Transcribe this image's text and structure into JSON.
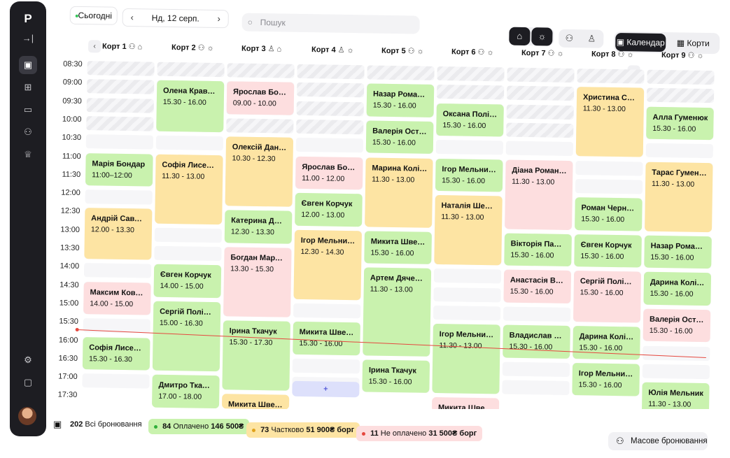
{
  "sidebar": {
    "logo": "P",
    "items": [
      {
        "name": "sidebar-collapse",
        "icon": "collapse-icon",
        "glyph": "→|"
      },
      {
        "name": "sidebar-item-calendar",
        "icon": "calendar-icon",
        "glyph": "▣",
        "active": true
      },
      {
        "name": "sidebar-item-dashboard",
        "icon": "grid-icon",
        "glyph": "⊞"
      },
      {
        "name": "sidebar-item-payments",
        "icon": "card-icon",
        "glyph": "▭"
      },
      {
        "name": "sidebar-item-clients",
        "icon": "users-icon",
        "glyph": "⚇"
      },
      {
        "name": "sidebar-item-tournaments",
        "icon": "trophy-icon",
        "glyph": "♕"
      },
      {
        "name": "sidebar-item-settings",
        "icon": "gear-icon",
        "glyph": "⚙"
      },
      {
        "name": "sidebar-item-chat",
        "icon": "chat-icon",
        "glyph": "▢"
      }
    ]
  },
  "toolbar": {
    "today_label": "Сьогодні",
    "date_label": "Нд, 12 серп.",
    "search_placeholder": "Пошук",
    "view_calendar": "Календар",
    "view_courts": "Корти"
  },
  "courts": [
    {
      "name": "Корт 1",
      "icons": "⚇ ⌂"
    },
    {
      "name": "Корт 2",
      "icons": "⚇ ☼"
    },
    {
      "name": "Корт 3",
      "icons": "♙ ⌂"
    },
    {
      "name": "Корт 4",
      "icons": "♙ ☼"
    },
    {
      "name": "Корт 5",
      "icons": "⚇ ☼"
    },
    {
      "name": "Корт 6",
      "icons": "⚇ ☼"
    },
    {
      "name": "Корт 7",
      "icons": "⚇ ☼"
    },
    {
      "name": "Корт 8",
      "icons": "⚇ ☼"
    },
    {
      "name": "Корт 9",
      "icons": "⚇ ☼"
    }
  ],
  "times": [
    "08:30",
    "09:00",
    "09:30",
    "10:00",
    "10:30",
    "11:00",
    "11:30",
    "12:00",
    "12:30",
    "13:00",
    "13:30",
    "14:00",
    "14:30",
    "15:00",
    "15:30",
    "16:00",
    "16:30",
    "17:00",
    "17:30"
  ],
  "bookings": [
    {
      "court": 0,
      "name": "Марія Бондар",
      "time": "11:00–12:00",
      "status": "g"
    },
    {
      "court": 0,
      "name": "Андрій Савчук",
      "time": "12.00 - 13.30",
      "status": "y"
    },
    {
      "court": 0,
      "name": "Максим Коваль",
      "time": "14.00 - 15.00",
      "status": "r"
    },
    {
      "court": 0,
      "name": "Софія Лисенко",
      "time": "15.30 - 16.30",
      "status": "g"
    },
    {
      "court": 1,
      "name": "Олена Кравець",
      "time": "15.30 - 16.00",
      "status": "g"
    },
    {
      "court": 1,
      "name": "Софія Лисенко",
      "time": "11.30 - 13.00",
      "status": "y"
    },
    {
      "court": 1,
      "name": "Євген Корчук",
      "time": "14.00 - 15.00",
      "status": "g"
    },
    {
      "court": 1,
      "name": "Сергій Поліщук",
      "time": "15.00 - 16.30",
      "status": "g"
    },
    {
      "court": 1,
      "name": "Дмитро Ткачук",
      "time": "17.00 - 18.00",
      "status": "g"
    },
    {
      "court": 2,
      "name": "Ярослав Бондар",
      "time": "09.00 - 10.00",
      "status": "r"
    },
    {
      "court": 2,
      "name": "Олексій Данилюк",
      "time": "10.30 - 12.30",
      "status": "y"
    },
    {
      "court": 2,
      "name": "Катерина Долинська",
      "time": "12.30 - 13.30",
      "status": "g"
    },
    {
      "court": 2,
      "name": "Богдан Марчук",
      "time": "13.30 - 15.30",
      "status": "r"
    },
    {
      "court": 2,
      "name": "Ірина Ткачук",
      "time": "15.30 - 17.30",
      "status": "g"
    },
    {
      "court": 2,
      "name": "Микита Швець",
      "time": "",
      "status": "y"
    },
    {
      "court": 3,
      "name": "Ярослав Бондар",
      "time": "11.00 - 12.00",
      "status": "r"
    },
    {
      "court": 3,
      "name": "Євген Корчук",
      "time": "12.00 - 13.00",
      "status": "g"
    },
    {
      "court": 3,
      "name": "Ігор Мельничук",
      "time": "12.30 - 14.30",
      "status": "y"
    },
    {
      "court": 3,
      "name": "Микита Швець",
      "time": "15.30 - 16.00",
      "status": "g"
    },
    {
      "court": 3,
      "name": "+",
      "time": "",
      "status": "add"
    },
    {
      "court": 4,
      "name": "Назар Романюк",
      "time": "15.30 - 16.00",
      "status": "g"
    },
    {
      "court": 4,
      "name": "Валерія Остапенко",
      "time": "15.30 - 16.00",
      "status": "g"
    },
    {
      "court": 4,
      "name": "Марина Колісник",
      "time": "11.30 - 13.00",
      "status": "y"
    },
    {
      "court": 4,
      "name": "Микита Швець",
      "time": "15.30 - 16.00",
      "status": "g"
    },
    {
      "court": 4,
      "name": "Артем Дяченко",
      "time": "11.30 - 13.00",
      "status": "g"
    },
    {
      "court": 4,
      "name": "Ірина Ткачук",
      "time": "15.30 - 16.00",
      "status": "g"
    },
    {
      "court": 5,
      "name": "Оксана Поліщук",
      "time": "15.30 - 16.00",
      "status": "g"
    },
    {
      "court": 5,
      "name": "Ігор Мельничук",
      "time": "15.30 - 16.00",
      "status": "g"
    },
    {
      "court": 5,
      "name": "Наталія Шевченко",
      "time": "11.30 - 13.00",
      "status": "y"
    },
    {
      "court": 5,
      "name": "Ігор Мельничук",
      "time": "11.30 - 13.00",
      "status": "g"
    },
    {
      "court": 5,
      "name": "Микита Швець",
      "time": "",
      "status": "r"
    },
    {
      "court": 6,
      "name": "Діана Романюк",
      "time": "11.30 - 13.00",
      "status": "r"
    },
    {
      "court": 6,
      "name": "Вікторія Павленко",
      "time": "15.30 - 16.00",
      "status": "g"
    },
    {
      "court": 6,
      "name": "Анастасія Величко",
      "time": "15.30 - 16.00",
      "status": "r"
    },
    {
      "court": 6,
      "name": "Владислав Петренко",
      "time": "15.30 - 16.00",
      "status": "g"
    },
    {
      "court": 7,
      "name": "Христина Соловйова",
      "time": "11.30 - 13.00",
      "status": "y"
    },
    {
      "court": 7,
      "name": "Роман Черненко",
      "time": "15.30 - 16.00",
      "status": "g"
    },
    {
      "court": 7,
      "name": "Євген Корчук",
      "time": "15.30 - 16.00",
      "status": "g"
    },
    {
      "court": 7,
      "name": "Сергій Поліщук",
      "time": "15.30 - 16.00",
      "status": "r"
    },
    {
      "court": 7,
      "name": "Дарина Колісник",
      "time": "15.30 - 16.00",
      "status": "g"
    },
    {
      "court": 7,
      "name": "Ігор Мельничук",
      "time": "15.30 - 16.00",
      "status": "g"
    },
    {
      "court": 8,
      "name": "Алла Гуменюк",
      "time": "15.30 - 16.00",
      "status": "g"
    },
    {
      "court": 8,
      "name": "Тарас Гуменюк",
      "time": "11.30 - 13.00",
      "status": "y"
    },
    {
      "court": 8,
      "name": "Назар Романюк",
      "time": "15.30 - 16.00",
      "status": "g"
    },
    {
      "court": 8,
      "name": "Дарина Колісник",
      "time": "15.30 - 16.00",
      "status": "g"
    },
    {
      "court": 8,
      "name": "Валерія Остапенко",
      "time": "15.30 - 16.00",
      "status": "r"
    },
    {
      "court": 8,
      "name": "Юлія Мельник",
      "time": "11.30 - 13.00",
      "status": "g"
    }
  ],
  "summary": {
    "total_count": "202",
    "total_label": "Всі бронювання",
    "paid_count": "84",
    "paid_label": "Оплачено",
    "paid_amount": "146 500₴",
    "partial_count": "73",
    "partial_label": "Частково",
    "partial_amount": "51 900₴ борг",
    "unpaid_count": "11",
    "unpaid_label": "Не оплачено",
    "unpaid_amount": "31 500₴ борг",
    "mass_booking_label": "Масове бронювання"
  },
  "colors": {
    "paid": "#c9f2ae",
    "partial": "#fde4a3",
    "unpaid": "#fddedf",
    "now_line": "#e5483f",
    "dark": "#1d1d22"
  }
}
